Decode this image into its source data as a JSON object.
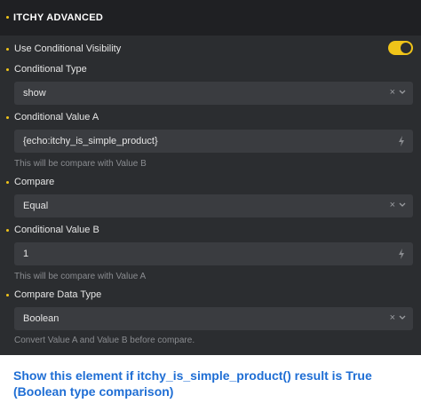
{
  "header": {
    "title": "ITCHY ADVANCED"
  },
  "use_conditional_visibility": {
    "label": "Use Conditional Visibility",
    "enabled": true
  },
  "conditional_type": {
    "label": "Conditional Type",
    "value": "show"
  },
  "conditional_value_a": {
    "label": "Conditional Value A",
    "value": "{echo:itchy_is_simple_product}",
    "help": "This will be compare with Value B"
  },
  "compare": {
    "label": "Compare",
    "value": "Equal"
  },
  "conditional_value_b": {
    "label": "Conditional Value B",
    "value": "1",
    "help": "This will be compare with Value A"
  },
  "compare_data_type": {
    "label": "Compare Data Type",
    "value": "Boolean",
    "help": "Convert Value A and Value B before compare."
  },
  "caption": {
    "text": "Show this element if itchy_is_simple_product() result is True (Boolean type comparison)"
  },
  "icons": {
    "clear": "×",
    "chevron": "chevron-down-icon",
    "bolt": "bolt-icon"
  },
  "colors": {
    "accent": "#f0c419",
    "panel": "#2b2d30",
    "header": "#1f2023",
    "field": "#3a3c40",
    "caption": "#1f6ed4"
  }
}
